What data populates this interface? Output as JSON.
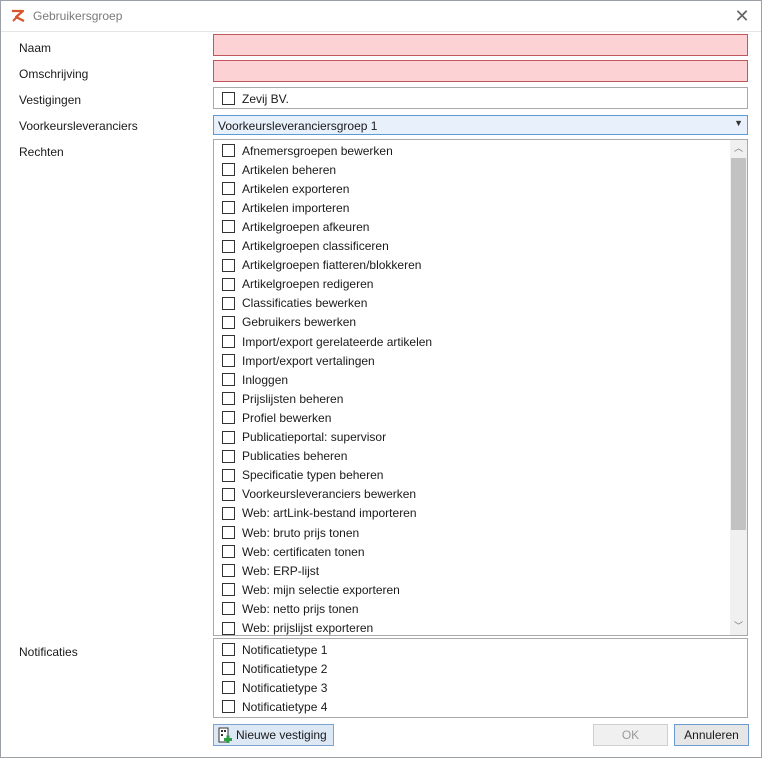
{
  "window": {
    "title": "Gebruikersgroep",
    "close_glyph": "✕"
  },
  "form": {
    "naam_label": "Naam",
    "naam_value": "",
    "omschrijving_label": "Omschrijving",
    "omschrijving_value": "",
    "vestigingen_label": "Vestigingen",
    "vestigingen": [
      {
        "label": "Zevij BV.",
        "checked": false
      }
    ],
    "voorkeur_label": "Voorkeursleveranciers",
    "voorkeur_value": "Voorkeursleveranciersgroep 1",
    "rechten_label": "Rechten",
    "rechten": [
      {
        "label": "Afnemersgroepen bewerken",
        "checked": false
      },
      {
        "label": "Artikelen beheren",
        "checked": false
      },
      {
        "label": "Artikelen exporteren",
        "checked": false
      },
      {
        "label": "Artikelen importeren",
        "checked": false
      },
      {
        "label": "Artikelgroepen afkeuren",
        "checked": false
      },
      {
        "label": "Artikelgroepen classificeren",
        "checked": false
      },
      {
        "label": "Artikelgroepen fiatteren/blokkeren",
        "checked": false
      },
      {
        "label": "Artikelgroepen redigeren",
        "checked": false
      },
      {
        "label": "Classificaties bewerken",
        "checked": false
      },
      {
        "label": "Gebruikers bewerken",
        "checked": false
      },
      {
        "label": "Import/export gerelateerde artikelen",
        "checked": false
      },
      {
        "label": "Import/export vertalingen",
        "checked": false
      },
      {
        "label": "Inloggen",
        "checked": false
      },
      {
        "label": "Prijslijsten beheren",
        "checked": false
      },
      {
        "label": "Profiel bewerken",
        "checked": false
      },
      {
        "label": "Publicatieportal: supervisor",
        "checked": false
      },
      {
        "label": "Publicaties beheren",
        "checked": false
      },
      {
        "label": "Specificatie typen beheren",
        "checked": false
      },
      {
        "label": "Voorkeursleveranciers bewerken",
        "checked": false
      },
      {
        "label": "Web: artLink-bestand importeren",
        "checked": false
      },
      {
        "label": "Web: bruto prijs tonen",
        "checked": false
      },
      {
        "label": "Web: certificaten tonen",
        "checked": false
      },
      {
        "label": "Web: ERP-lijst",
        "checked": false
      },
      {
        "label": "Web: mijn selectie exporteren",
        "checked": false
      },
      {
        "label": "Web: netto prijs tonen",
        "checked": false
      },
      {
        "label": "Web: prijslijst exporteren",
        "checked": false
      }
    ],
    "notificaties_label": "Notificaties",
    "notificaties": [
      {
        "label": "Notificatietype 1",
        "checked": false
      },
      {
        "label": "Notificatietype 2",
        "checked": false
      },
      {
        "label": "Notificatietype 3",
        "checked": false
      },
      {
        "label": "Notificatietype 4",
        "checked": false
      }
    ]
  },
  "buttons": {
    "new_location": "Nieuwe vestiging",
    "ok": "OK",
    "cancel": "Annuleren"
  },
  "colors": {
    "invalid_fill": "#fcd2d5",
    "invalid_border": "#c0565e",
    "accent": "#5a9bd5"
  }
}
